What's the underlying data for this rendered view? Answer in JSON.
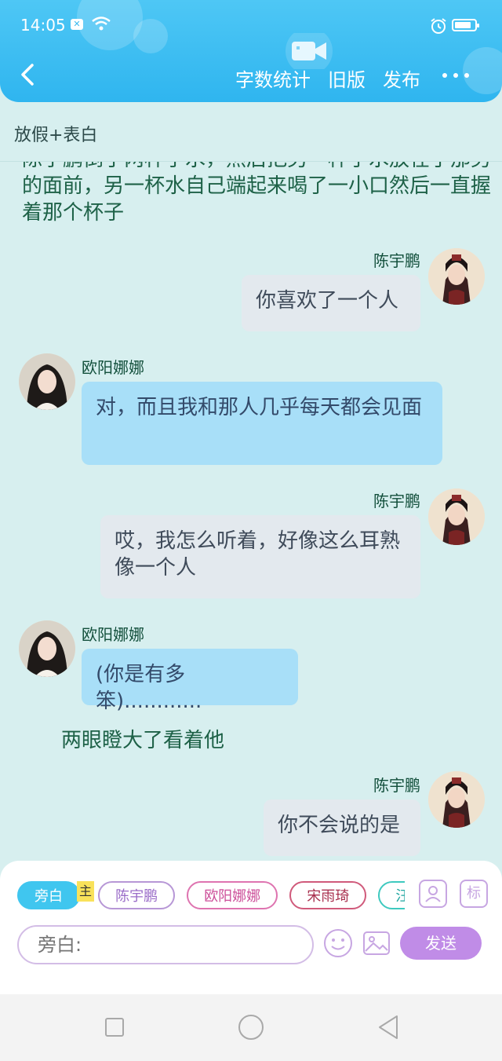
{
  "status": {
    "time": "14:05",
    "notification_glyph": "✕"
  },
  "header": {
    "actions": [
      "字数统计",
      "旧版",
      "发布"
    ],
    "accent": "#35b8f0"
  },
  "story": {
    "title": "放假+表白"
  },
  "chat": {
    "top_narration": "陈宇鹏倒了两杯子水，然后把另一杯子水放在了那男的面前，另一杯水自己端起来喝了一小口然后一直握着那个杯子",
    "messages": [
      {
        "speaker": "陈宇鹏",
        "side": "right",
        "text": "你喜欢了一个人"
      },
      {
        "speaker": "欧阳娜娜",
        "side": "left",
        "text": "对，而且我和那人几乎每天都会见面"
      },
      {
        "speaker": "陈宇鹏",
        "side": "right",
        "text": "哎，我怎么听着，好像这么耳熟像一个人"
      },
      {
        "speaker": "欧阳娜娜",
        "side": "left",
        "text": "(你是有多笨)............"
      }
    ],
    "narration_2": "两眼瞪大了看着他",
    "last_message": {
      "speaker": "陈宇鹏",
      "side": "right",
      "text": "你不会说的是"
    }
  },
  "composer": {
    "chips": [
      "旁白",
      "陈宇鹏",
      "欧阳娜娜",
      "宋雨琦",
      "汪苏泷"
    ],
    "main_badge": "主",
    "tag_icon_label": "标",
    "input_placeholder": "旁白:",
    "send_label": "发送"
  }
}
